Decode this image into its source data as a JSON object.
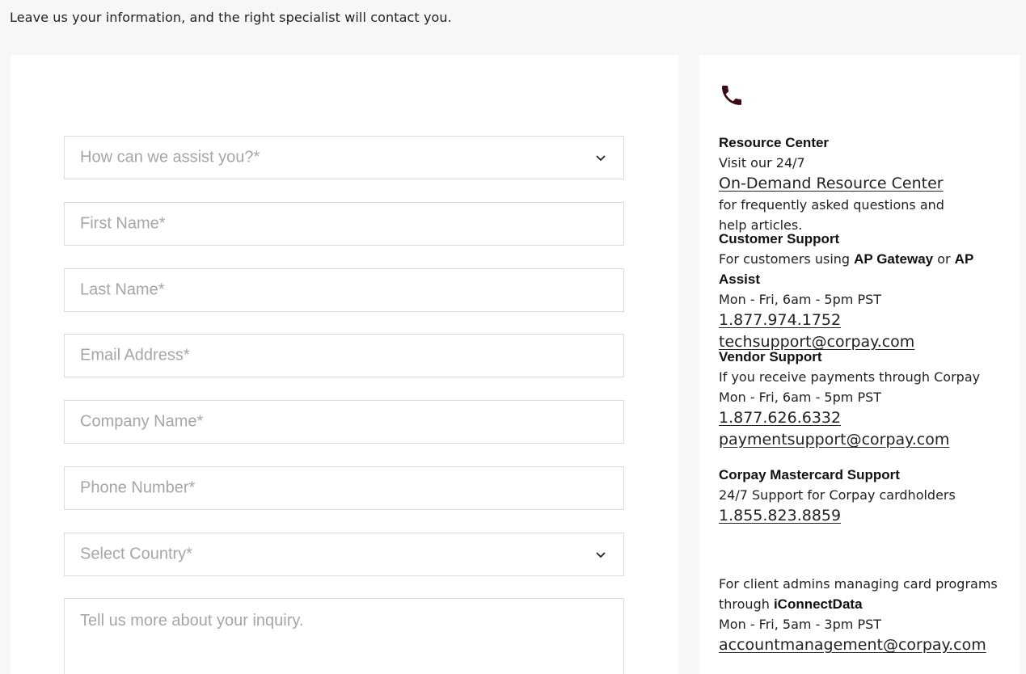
{
  "intro_text": "Leave us your information, and the right specialist will contact you.",
  "form": {
    "assist_placeholder": "How can we assist you?*",
    "first_name_placeholder": "First Name*",
    "last_name_placeholder": "Last Name*",
    "email_placeholder": "Email Address*",
    "company_placeholder": "Company Name*",
    "phone_placeholder": "Phone Number*",
    "country_placeholder": "Select Country*",
    "inquiry_placeholder": "Tell us more about your inquiry."
  },
  "sidebar": {
    "icon": "phone-icon",
    "resource": {
      "heading": "Resource Center",
      "line1_prefix": "Visit our 24/7 ",
      "link": "On-Demand Resource Center",
      "line2": "for frequently asked questions and",
      "line3": "help articles."
    },
    "customer": {
      "heading": "Customer Support",
      "desc_prefix": "For customers using ",
      "product1": "AP Gateway",
      "desc_mid": " or ",
      "product2": "AP Assist",
      "hours": "Mon - Fri, 6am - 5pm PST",
      "phone": "1.877.974.1752",
      "email": "techsupport@corpay.com"
    },
    "vendor": {
      "heading": "Vendor Support",
      "desc": "If you receive payments through Corpay",
      "hours": "Mon - Fri, 6am - 5pm PST",
      "phone": "1.877.626.6332",
      "email": "paymentsupport@corpay.com"
    },
    "mastercard": {
      "heading": "Corpay Mastercard Support",
      "desc": "24/7 Support for Corpay cardholders",
      "phone": "1.855.823.8859"
    },
    "admins": {
      "line1": "For client admins managing card programs",
      "line2_prefix": "through ",
      "product": "iConnectData",
      "hours": "Mon - Fri, 5am - 3pm PST",
      "email": "accountmanagement@corpay.com"
    }
  }
}
